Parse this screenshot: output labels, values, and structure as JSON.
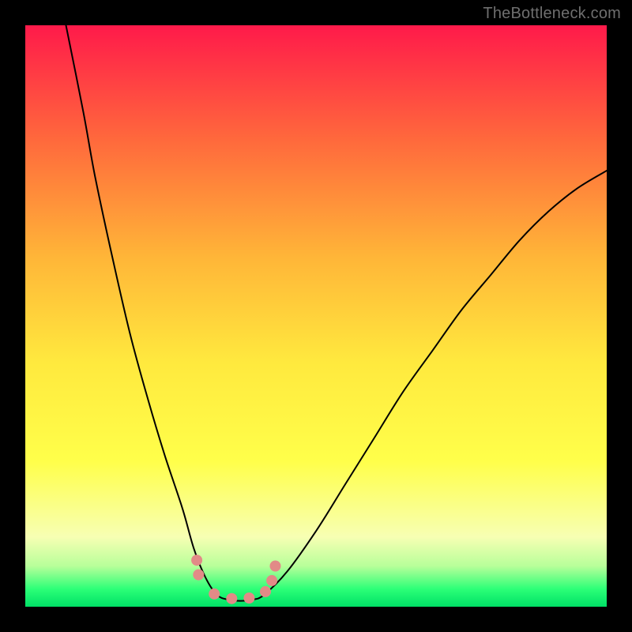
{
  "watermark": "TheBottleneck.com",
  "colors": {
    "frame": "#000000",
    "gradient_top": "#ff1a4a",
    "gradient_mid1": "#ff6a3c",
    "gradient_mid2": "#ffb638",
    "gradient_mid3": "#ffe93e",
    "gradient_yellow": "#ffff4a",
    "gradient_pale": "#f7ffb3",
    "gradient_light_green": "#b8ff9a",
    "gradient_green": "#2bff77",
    "gradient_bottom": "#00e066",
    "curve": "#000000",
    "dots": "#e28a87"
  },
  "chart_data": {
    "type": "line",
    "title": "",
    "xlabel": "",
    "ylabel": "",
    "xlim": [
      0,
      100
    ],
    "ylim": [
      0,
      100
    ],
    "note": "V-shaped bottleneck curve over a vertical red→orange→yellow→green gradient; minima near x≈33–40 at y≈1–3; y≈100 at left edge; right end rises to y≈75 at x=100. Six salmon marker dots cluster around the valley.",
    "series": [
      {
        "name": "left-branch",
        "x": [
          7,
          10,
          12,
          15,
          18,
          21,
          24,
          27,
          29,
          31,
          33
        ],
        "y": [
          100,
          85,
          74,
          60,
          47,
          36,
          26,
          17,
          10,
          5,
          2
        ]
      },
      {
        "name": "valley-floor",
        "x": [
          33,
          35,
          37,
          39,
          41
        ],
        "y": [
          2,
          1.2,
          1,
          1.2,
          2
        ]
      },
      {
        "name": "right-branch",
        "x": [
          41,
          45,
          50,
          55,
          60,
          65,
          70,
          75,
          80,
          85,
          90,
          95,
          100
        ],
        "y": [
          2,
          6,
          13,
          21,
          29,
          37,
          44,
          51,
          57,
          63,
          68,
          72,
          75
        ]
      }
    ],
    "markers": {
      "name": "valley-dots",
      "x": [
        29.5,
        29.8,
        32.5,
        35.5,
        38.5,
        41.3,
        42.4,
        43.0
      ],
      "y": [
        8.0,
        5.5,
        2.2,
        1.4,
        1.5,
        2.6,
        4.5,
        7.0
      ]
    }
  }
}
